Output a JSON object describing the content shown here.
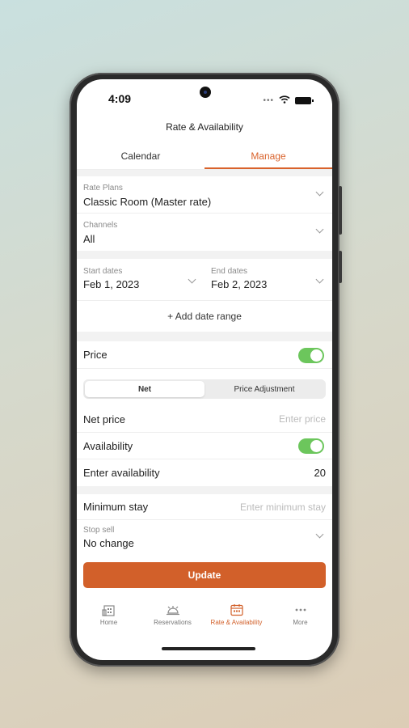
{
  "status_bar": {
    "time": "4:09"
  },
  "header": {
    "title": "Rate & Availability"
  },
  "tabs": [
    {
      "label": "Calendar"
    },
    {
      "label": "Manage"
    }
  ],
  "rate_plans": {
    "label": "Rate Plans",
    "value": "Classic Room (Master rate)"
  },
  "channels": {
    "label": "Channels",
    "value": "All"
  },
  "start_dates": {
    "label": "Start dates",
    "value": "Feb 1, 2023"
  },
  "end_dates": {
    "label": "End dates",
    "value": "Feb 2, 2023"
  },
  "add_date_range": "+ Add date range",
  "price": {
    "label": "Price",
    "enabled": true
  },
  "price_mode": {
    "options": [
      "Net",
      "Price Adjustment"
    ],
    "selected": "Net"
  },
  "net_price": {
    "label": "Net price",
    "placeholder": "Enter price"
  },
  "availability": {
    "label": "Availability",
    "enabled": true
  },
  "enter_availability": {
    "label": "Enter availability",
    "value": "20"
  },
  "minimum_stay": {
    "label": "Minimum stay",
    "placeholder": "Enter minimum stay"
  },
  "stop_sell": {
    "label": "Stop sell",
    "value": "No change"
  },
  "update_button": "Update",
  "bottom_nav": [
    {
      "label": "Home",
      "icon": "building-icon"
    },
    {
      "label": "Reservations",
      "icon": "bell-icon"
    },
    {
      "label": "Rate & Availability",
      "icon": "calendar-icon"
    },
    {
      "label": "More",
      "icon": "more-icon"
    }
  ],
  "colors": {
    "accent": "#d2602a",
    "toggle_on": "#6cc65c"
  }
}
